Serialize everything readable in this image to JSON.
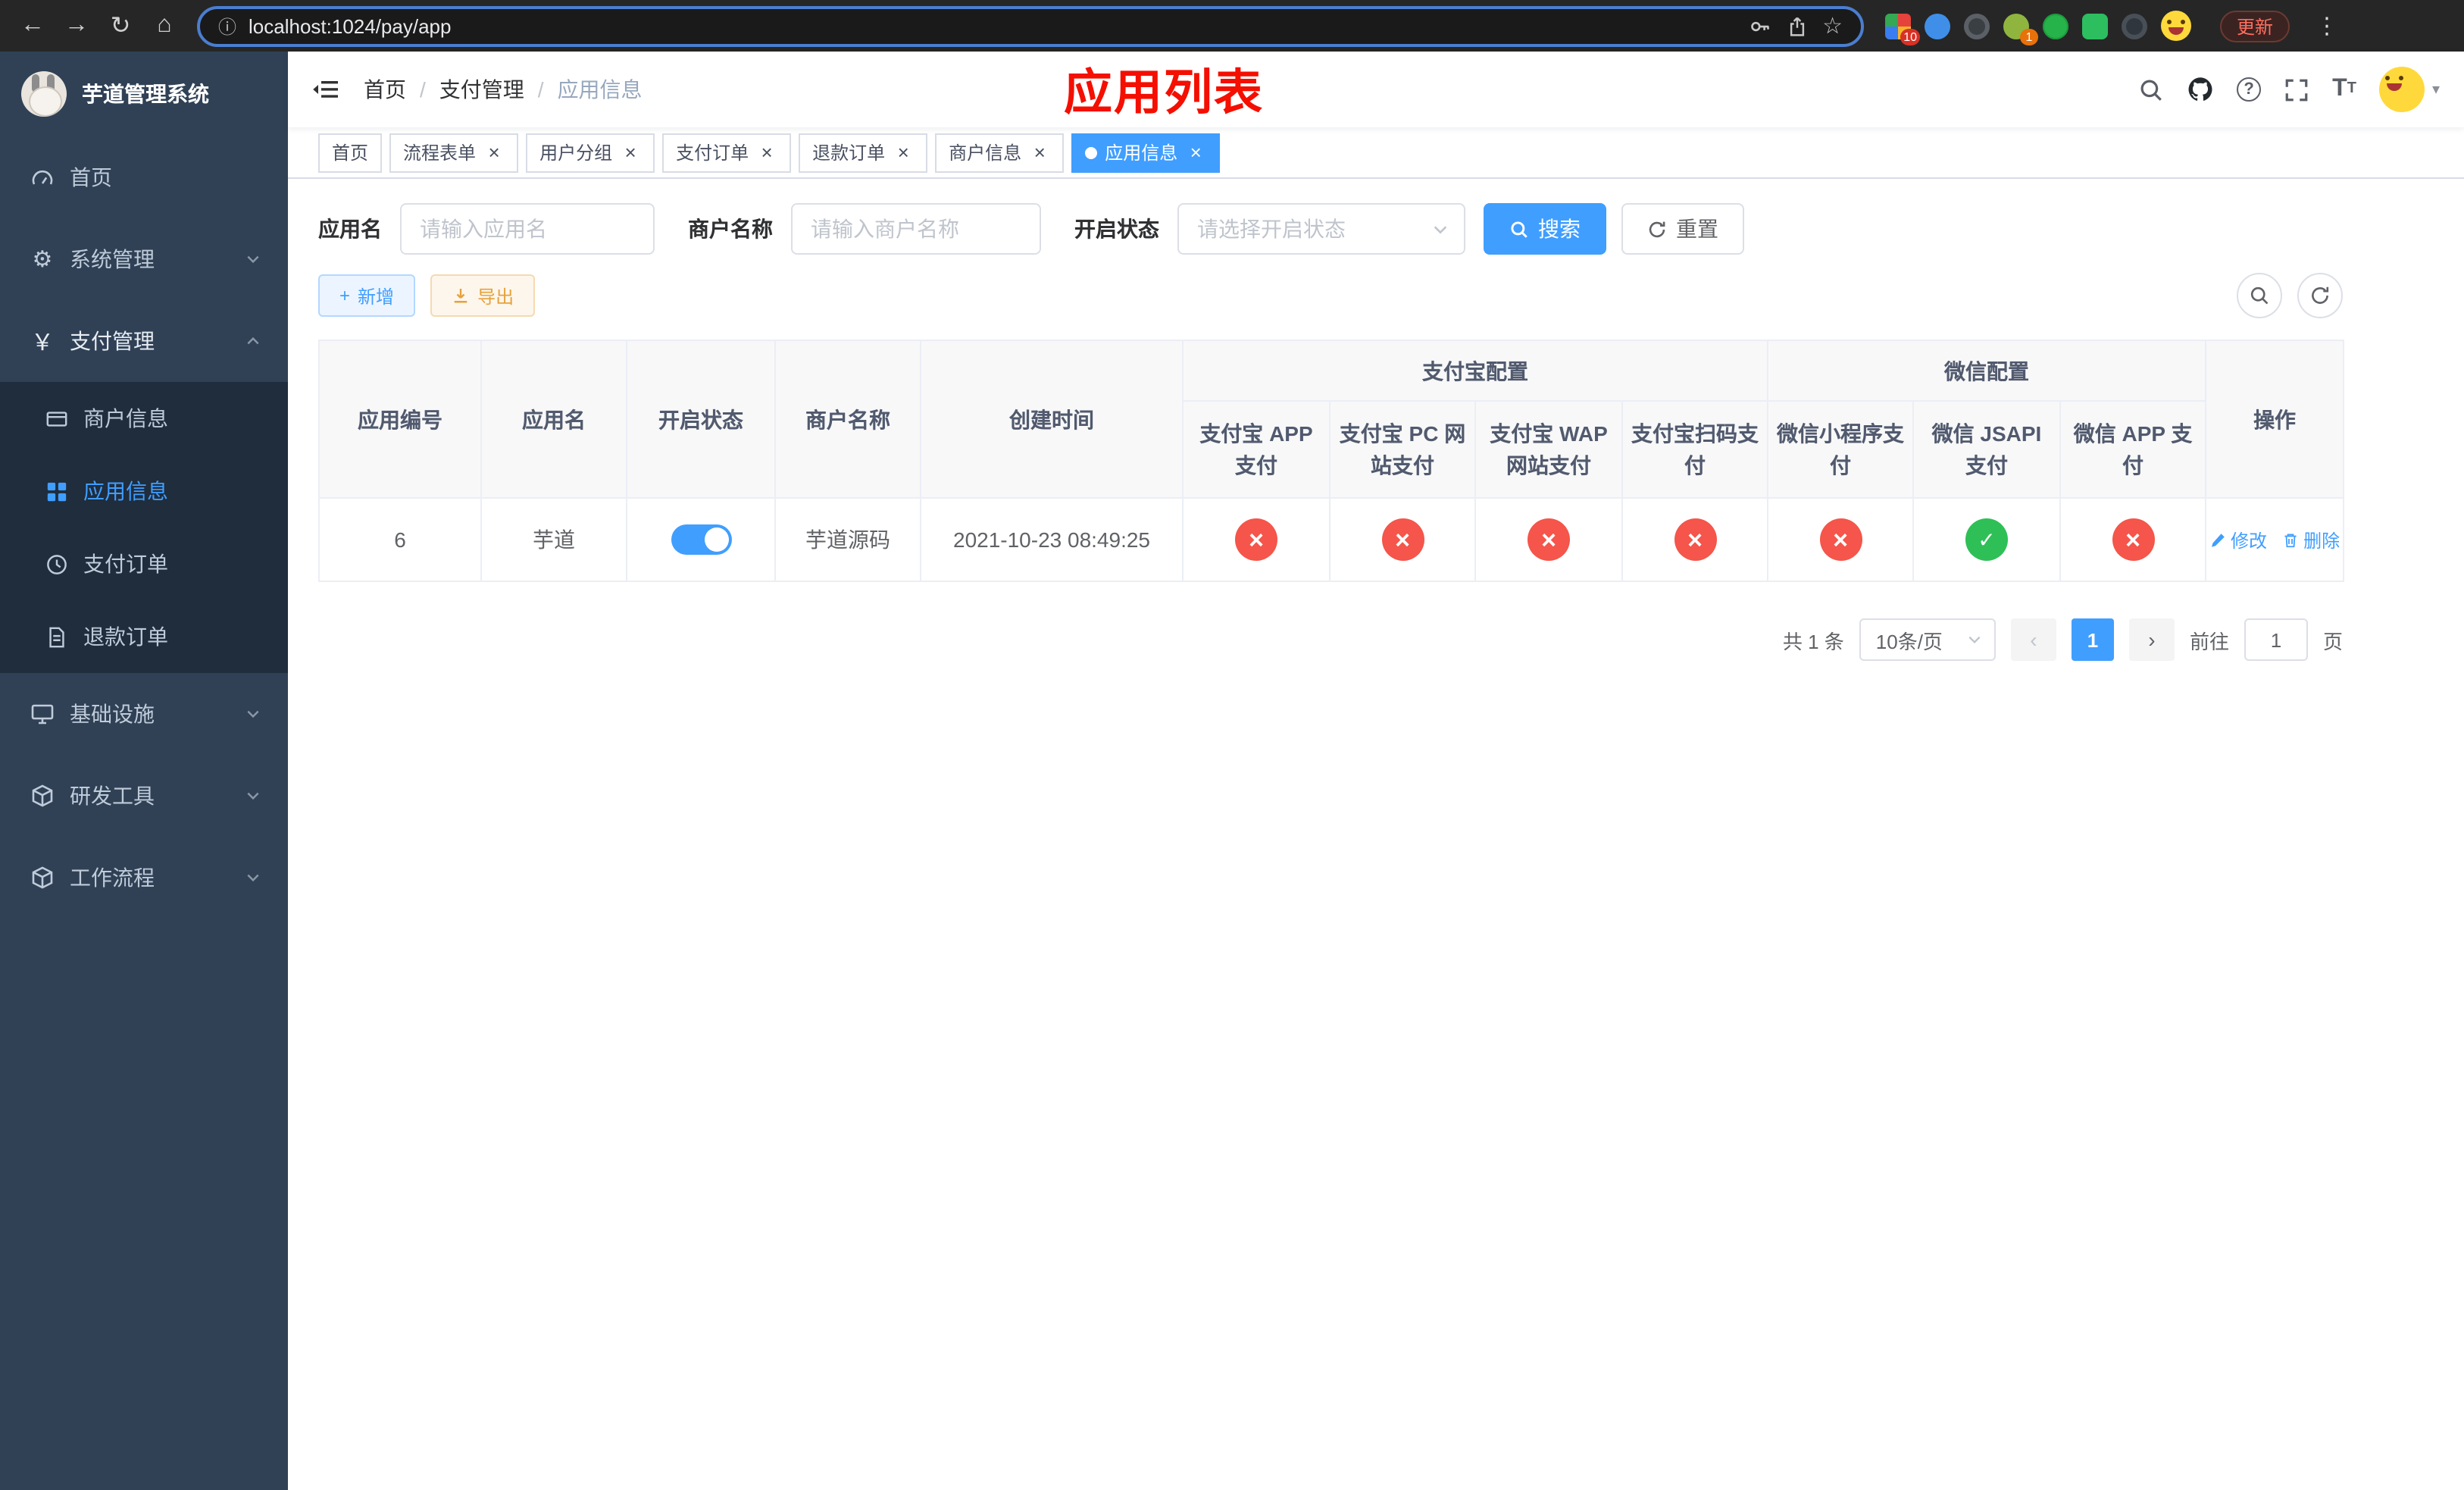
{
  "browser": {
    "url": "localhost:1024/pay/app",
    "update_label": "更新",
    "extension_badges": {
      "grid": "10",
      "profile": "1"
    }
  },
  "icons": {
    "back": "←",
    "forward": "→",
    "reload": "↻",
    "home": "⌂",
    "info": "ⓘ",
    "star": "☆",
    "overflow": "⋮",
    "close": "×",
    "plus": "+",
    "breadcrumb_sep": "/",
    "prev": "‹",
    "next": "›",
    "caret_down": "▾",
    "gear": "⚙",
    "yen": "￥",
    "question": "?",
    "font_size": "T"
  },
  "sidebar": {
    "app_title": "芋道管理系统",
    "items": [
      {
        "label": "首页"
      },
      {
        "label": "系统管理"
      },
      {
        "label": "支付管理"
      },
      {
        "label": "基础设施"
      },
      {
        "label": "研发工具"
      },
      {
        "label": "工作流程"
      }
    ],
    "submenu": [
      {
        "label": "商户信息"
      },
      {
        "label": "应用信息",
        "active": true
      },
      {
        "label": "支付订单"
      },
      {
        "label": "退款订单"
      }
    ]
  },
  "navbar": {
    "breadcrumb": [
      "首页",
      "支付管理",
      "应用信息"
    ],
    "overlay_title": "应用列表"
  },
  "tabs": [
    {
      "label": "首页"
    },
    {
      "label": "流程表单",
      "closable": true
    },
    {
      "label": "用户分组",
      "closable": true
    },
    {
      "label": "支付订单",
      "closable": true
    },
    {
      "label": "退款订单",
      "closable": true
    },
    {
      "label": "商户信息",
      "closable": true
    },
    {
      "label": "应用信息",
      "closable": true,
      "active": true
    }
  ],
  "filters": {
    "app_name_label": "应用名",
    "app_name_placeholder": "请输入应用名",
    "merchant_label": "商户名称",
    "merchant_placeholder": "请输入商户名称",
    "status_label": "开启状态",
    "status_placeholder": "请选择开启状态",
    "search_label": "搜索",
    "reset_label": "重置"
  },
  "toolbar": {
    "add_label": "新增",
    "export_label": "导出"
  },
  "table": {
    "simple_columns": [
      "应用编号",
      "应用名",
      "开启状态",
      "商户名称",
      "创建时间"
    ],
    "alipay_group": "支付宝配置",
    "alipay_columns": [
      "支付宝 APP 支付",
      "支付宝 PC 网站支付",
      "支付宝 WAP 网站支付",
      "支付宝扫码支付"
    ],
    "wechat_group": "微信配置",
    "wechat_columns": [
      "微信小程序支付",
      "微信 JSAPI 支付",
      "微信 APP 支付"
    ],
    "actions_column": "操作",
    "rows": [
      {
        "id": "6",
        "name": "芋道",
        "enabled": true,
        "merchant": "芋道源码",
        "created_at": "2021-10-23 08:49:25",
        "statuses": [
          false,
          false,
          false,
          false,
          false,
          true,
          false
        ],
        "edit_label": "修改",
        "delete_label": "删除"
      }
    ]
  },
  "pagination": {
    "total_label": "共 1 条",
    "page_size_label": "10条/页",
    "page": "1",
    "goto_label": "前往",
    "goto_value": "1",
    "goto_unit": "页"
  },
  "colors": {
    "primary": "#409eff",
    "success": "#2fbf57",
    "danger": "#f5554a",
    "warning": "#e6a23c",
    "sidebar_bg": "#304156",
    "submenu_bg": "#1f2d3d",
    "overlay_title_red": "#f40f00"
  }
}
